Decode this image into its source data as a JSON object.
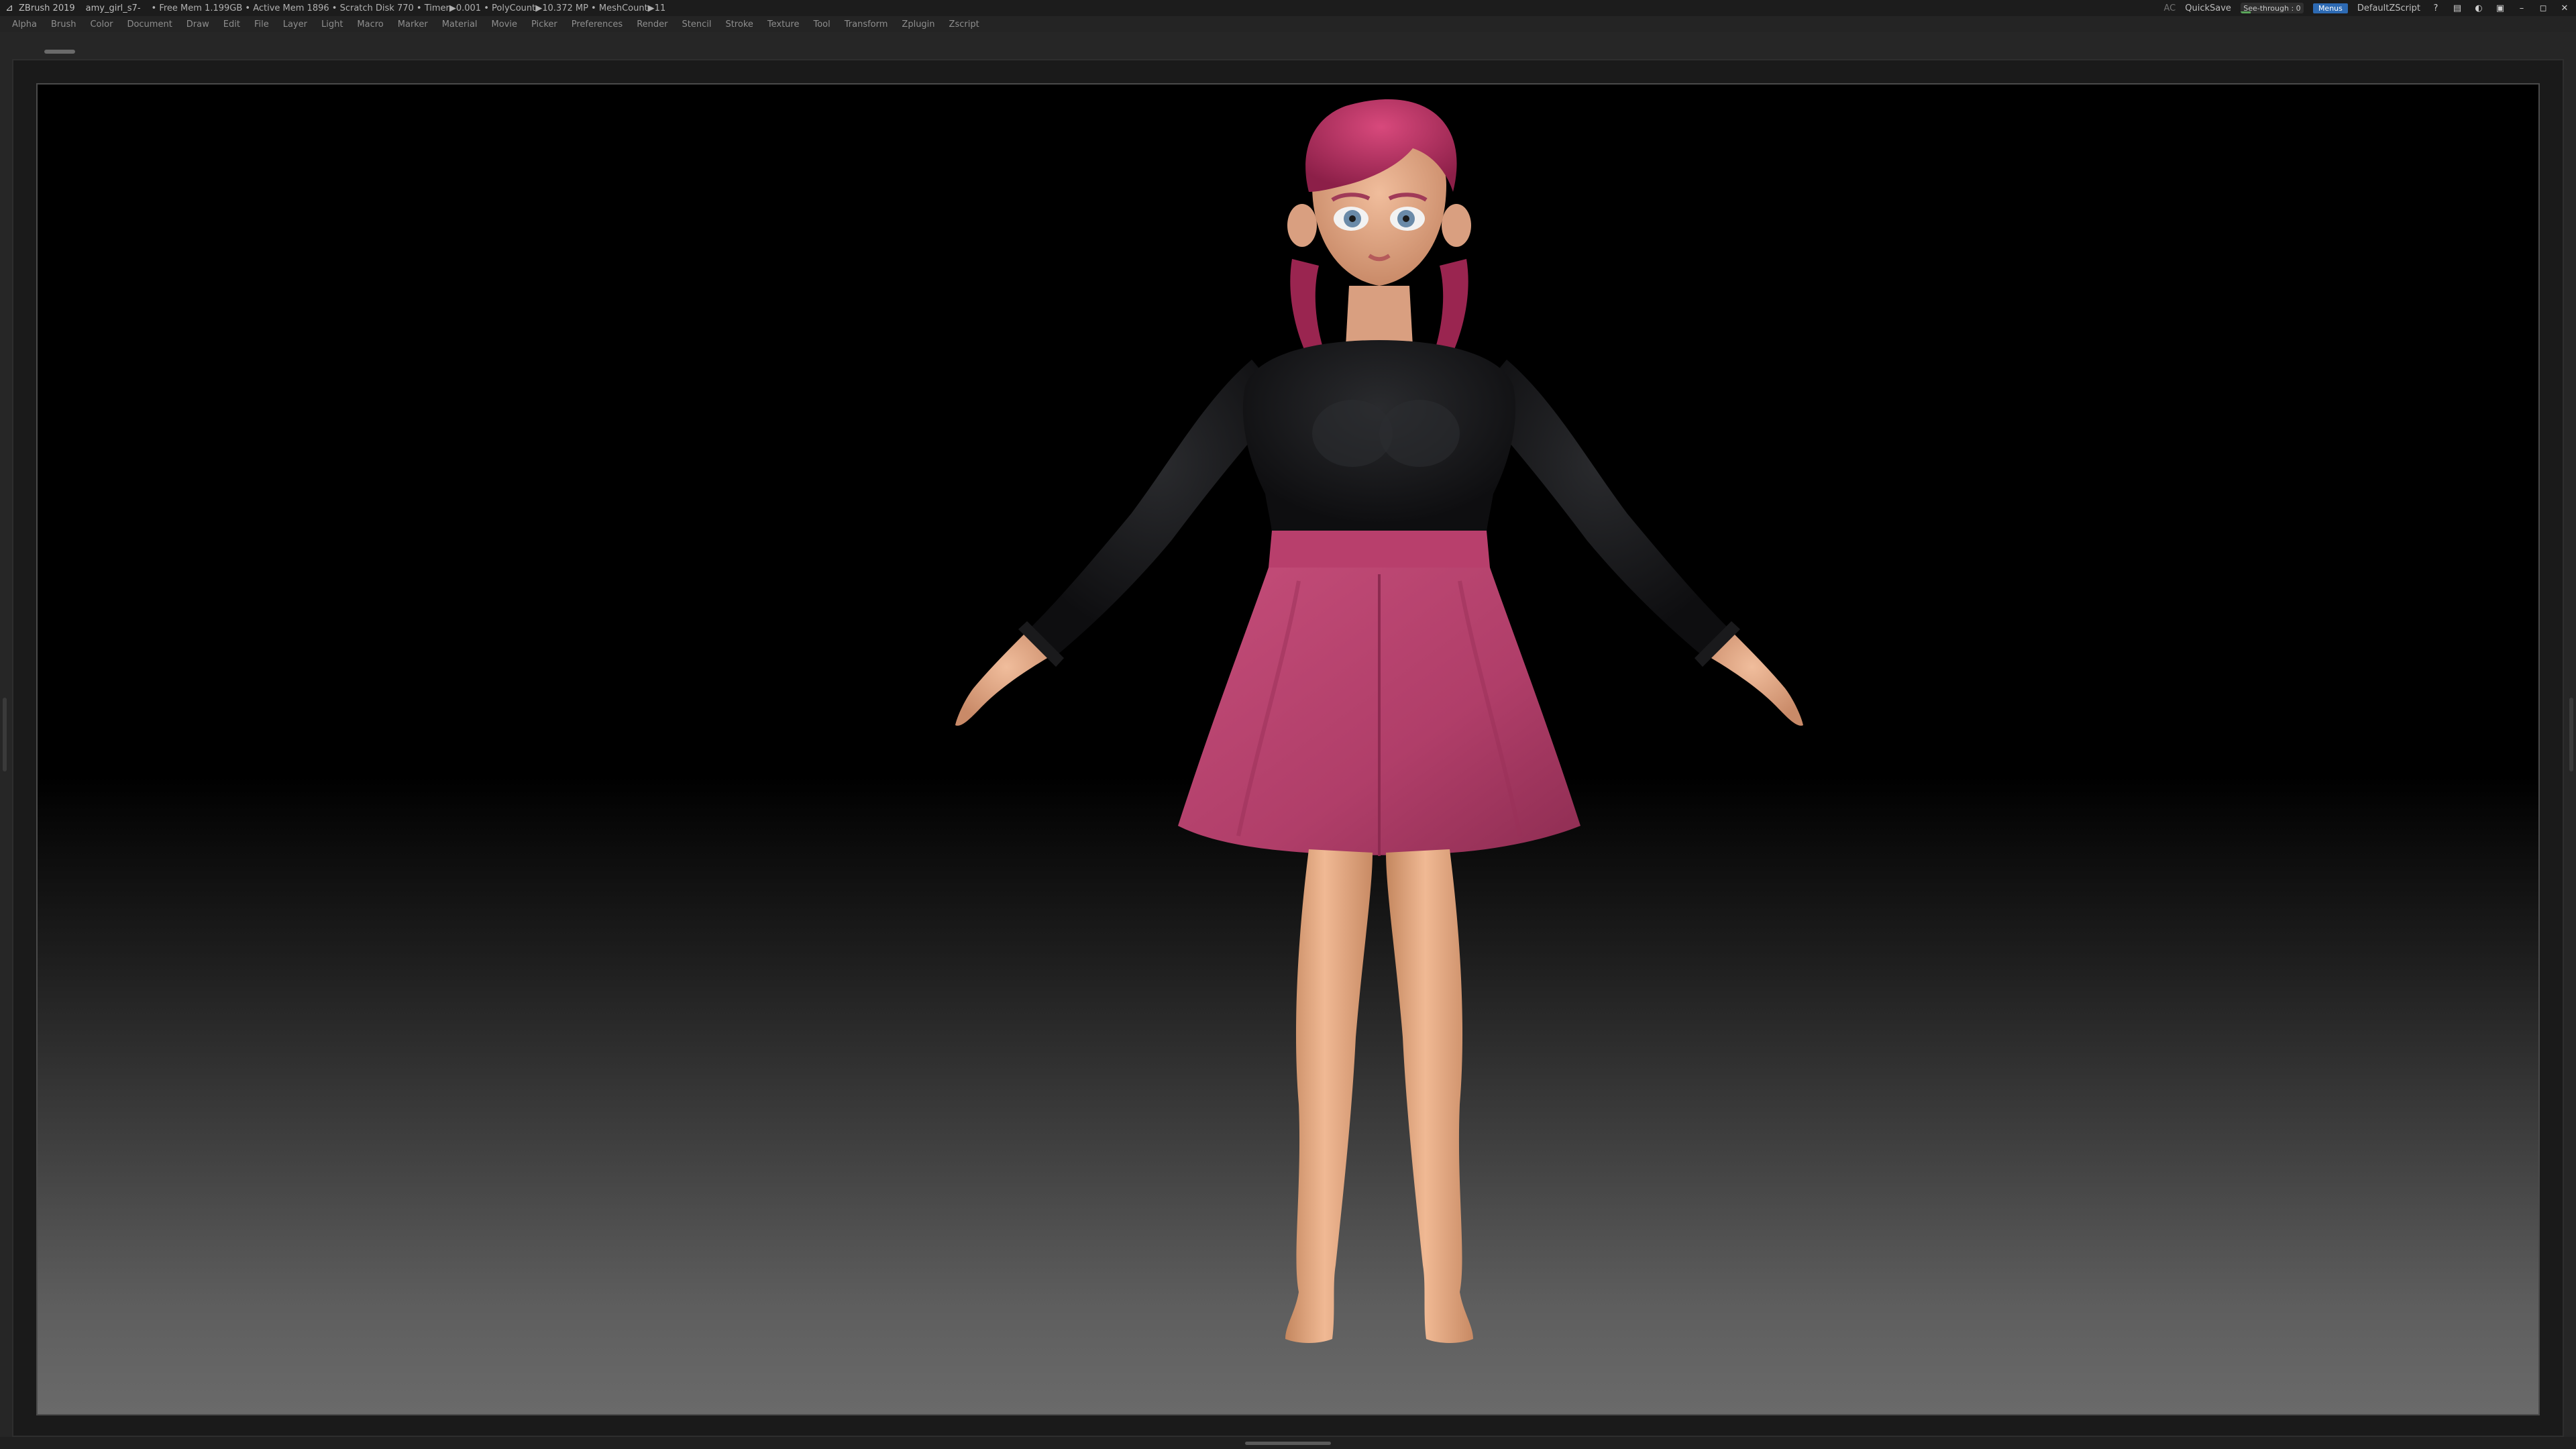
{
  "titlebar": {
    "app_name": "ZBrush 2019",
    "document": "amy_girl_s7-",
    "status": "• Free Mem 1.199GB • Active Mem 1896 • Scratch Disk 770 • Timer▶0.001 • PolyCount▶10.372 MP • MeshCount▶11",
    "ac": "AC",
    "quicksave": "QuickSave",
    "see_through_label": "See-through : 0",
    "see_through_value": 0,
    "menus": "Menus",
    "default_zscript": "DefaultZScript"
  },
  "menubar": {
    "items": [
      "Alpha",
      "Brush",
      "Color",
      "Document",
      "Draw",
      "Edit",
      "File",
      "Layer",
      "Light",
      "Macro",
      "Marker",
      "Material",
      "Movie",
      "Picker",
      "Preferences",
      "Render",
      "Stencil",
      "Stroke",
      "Texture",
      "Tool",
      "Transform",
      "Zplugin",
      "Zscript"
    ]
  },
  "icons": {
    "app_logo": "zbrush-logo-icon",
    "window_controls": [
      "help-icon",
      "layout-icon",
      "palette-icon",
      "lock-icon",
      "minimize-icon",
      "restore-icon",
      "close-icon"
    ]
  },
  "colors": {
    "hair": "#b02a5c",
    "skin": "#e0a888",
    "sweater": "#141416",
    "skirt": "#b8406c",
    "accent_blue": "#2d6ab3",
    "seethrough_green": "#5aa55a"
  }
}
